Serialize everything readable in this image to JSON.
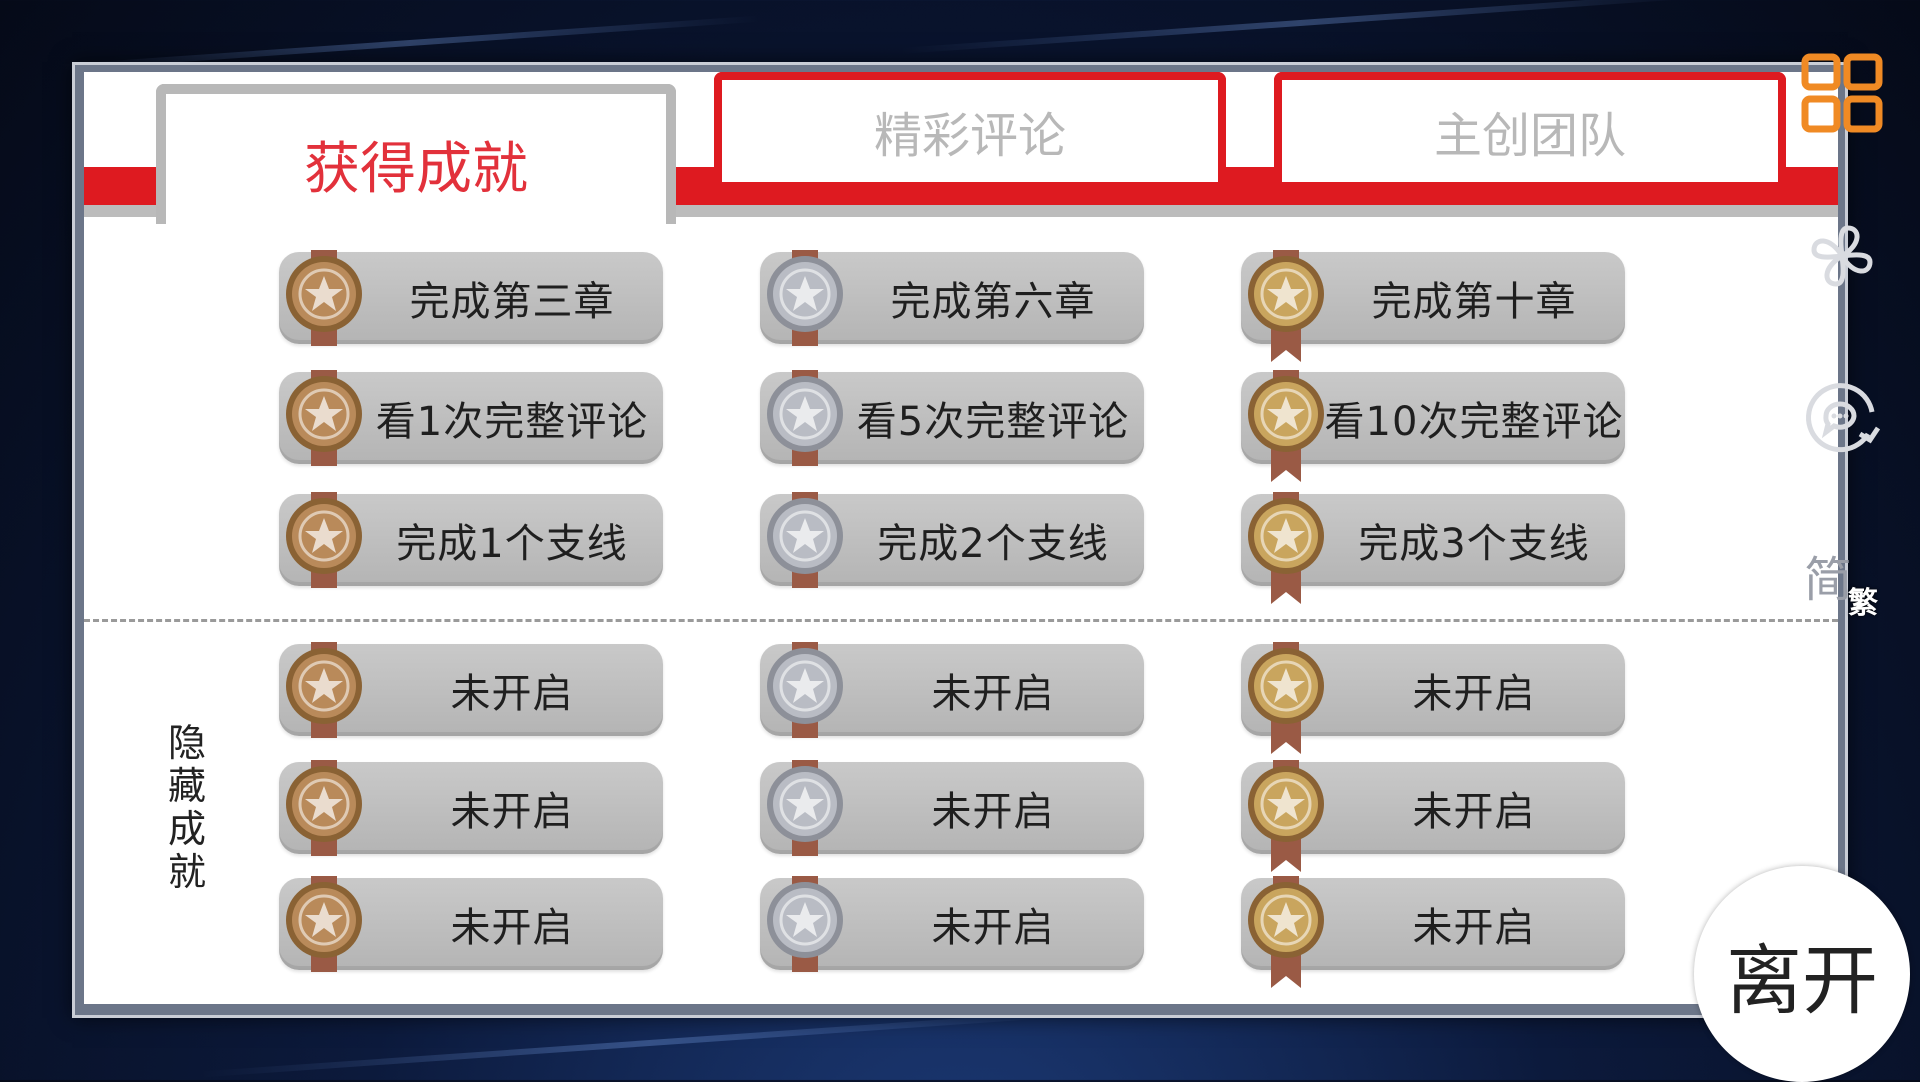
{
  "tabs": [
    {
      "label": "获得成就",
      "active": true
    },
    {
      "label": "精彩评论",
      "active": false
    },
    {
      "label": "主创团队",
      "active": false
    }
  ],
  "achievements": [
    [
      {
        "label": "完成第三章",
        "medal": "bronze"
      },
      {
        "label": "完成第六章",
        "medal": "silver"
      },
      {
        "label": "完成第十章",
        "medal": "gold"
      }
    ],
    [
      {
        "label": "看1次完整评论",
        "medal": "bronze"
      },
      {
        "label": "看5次完整评论",
        "medal": "silver"
      },
      {
        "label": "看10次完整评论",
        "medal": "gold"
      }
    ],
    [
      {
        "label": "完成1个支线",
        "medal": "bronze"
      },
      {
        "label": "完成2个支线",
        "medal": "silver"
      },
      {
        "label": "完成3个支线",
        "medal": "gold"
      }
    ]
  ],
  "hidden_section": {
    "title": "隐藏成就",
    "rows": [
      [
        {
          "label": "未开启",
          "medal": "bronze"
        },
        {
          "label": "未开启",
          "medal": "silver"
        },
        {
          "label": "未开启",
          "medal": "gold"
        }
      ],
      [
        {
          "label": "未开启",
          "medal": "bronze"
        },
        {
          "label": "未开启",
          "medal": "silver"
        },
        {
          "label": "未开启",
          "medal": "gold"
        }
      ],
      [
        {
          "label": "未开启",
          "medal": "bronze"
        },
        {
          "label": "未开启",
          "medal": "silver"
        },
        {
          "label": "未开启",
          "medal": "gold"
        }
      ]
    ]
  },
  "side_icons": [
    {
      "name": "grid-menu-icon"
    },
    {
      "name": "clover-icon"
    },
    {
      "name": "comment-refresh-icon"
    }
  ],
  "language": {
    "simplified": "简",
    "traditional": "繁"
  },
  "leave_label": "离开",
  "colors": {
    "accent_red": "#de1a20",
    "active_tab_text": "#e2313b",
    "medal_bronze": "#b98a5a",
    "medal_silver": "#b9bcc4",
    "medal_gold": "#c9a55e",
    "ribbon": "#9a5a45",
    "grid_icon": "#f08a24"
  }
}
